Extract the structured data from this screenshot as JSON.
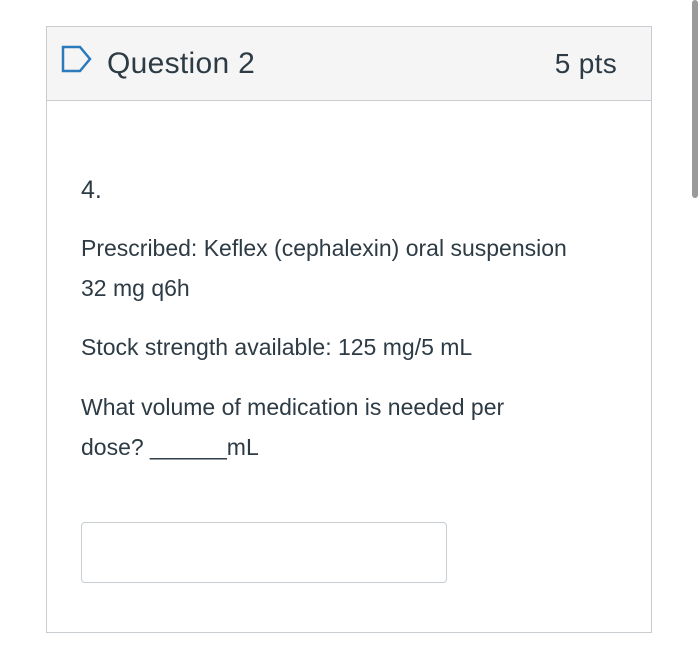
{
  "question": {
    "title": "Question 2",
    "points": "5 pts",
    "number": "4.",
    "prescribed_line1": "Prescribed: Keflex (cephalexin) oral suspension",
    "prescribed_line2": "32 mg q6h",
    "stock": "Stock strength available: 125 mg/5 mL",
    "prompt_line1": "What volume of medication is needed per",
    "prompt_line2": "dose? ______mL",
    "answer_value": ""
  },
  "icons": {
    "flag": "bookmark-flag-icon"
  },
  "colors": {
    "flag_stroke": "#2b7abc",
    "header_bg": "#f5f5f5",
    "border": "#c7cdd1",
    "text": "#2d3b45"
  }
}
